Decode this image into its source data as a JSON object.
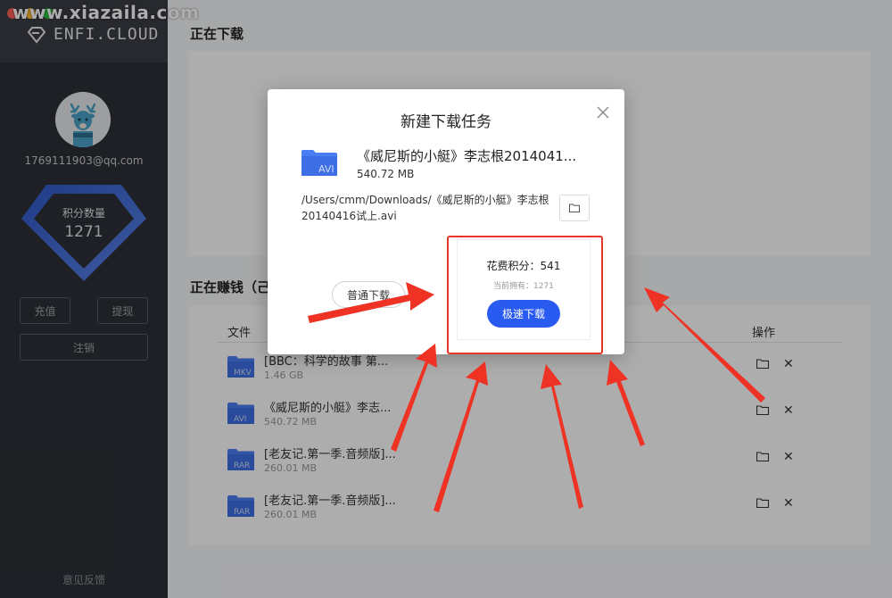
{
  "watermark": "www.xiazaila.com",
  "app": {
    "logo_text": "ENFI.CLOUD"
  },
  "sidebar": {
    "email": "1769111903@qq.com",
    "points_label": "积分数量",
    "points_value": "1271",
    "recharge_label": "充值",
    "withdraw_label": "提现",
    "logout_label": "注销",
    "feedback_label": "意见反馈"
  },
  "main": {
    "downloading_title": "正在下载",
    "earning_title": "正在赚钱（己",
    "columns": {
      "file": "文件",
      "ops": "操作"
    },
    "rows": [
      {
        "badge": "MKV",
        "name": "[BBC：科学的故事 第...",
        "size": "1.46 GB"
      },
      {
        "badge": "AVI",
        "name": "《威尼斯的小艇》李志...",
        "size": "540.72 MB"
      },
      {
        "badge": "RAR",
        "name": "[老友记.第一季.音频版]...",
        "size": "260.01 MB"
      },
      {
        "badge": "RAR",
        "name": "[老友记.第一季.音频版]...",
        "size": "260.01 MB"
      }
    ]
  },
  "dialog": {
    "title": "新建下载任务",
    "file_badge": "AVI",
    "file_name": "《威尼斯的小艇》李志根2014041...",
    "file_size": "540.72 MB",
    "path": "/Users/cmm/Downloads/《威尼斯的小艇》李志根20140416试上.avi",
    "normal_download_label": "普通下载",
    "cost_label": "花费积分：541",
    "owned_label": "当前拥有：1271",
    "fast_download_label": "极速下载"
  },
  "colors": {
    "accent": "#2a5bf0",
    "sidebar_bg": "#2d3037",
    "annotation_red": "#e8372a",
    "folder_blue": "#4a7ef5"
  }
}
